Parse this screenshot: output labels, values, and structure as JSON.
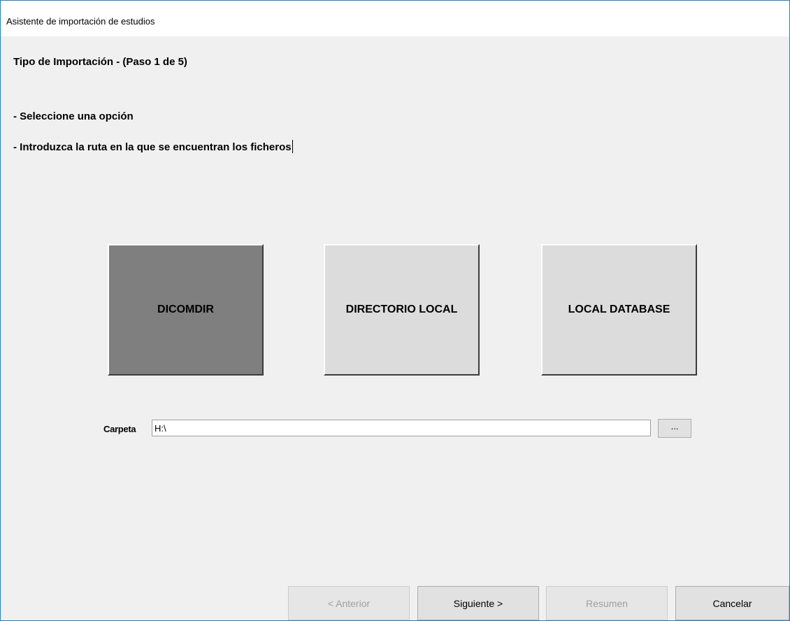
{
  "window": {
    "title": "Asistente de importación de estudios"
  },
  "step": {
    "title": "Tipo de Importación - (Paso 1 de 5)",
    "instructions": [
      "- Seleccione una opción",
      "- Introduzca la ruta en la que se encuentran los ficheros"
    ]
  },
  "options": [
    {
      "label": "DICOMDIR",
      "selected": true
    },
    {
      "label": "DIRECTORIO LOCAL",
      "selected": false
    },
    {
      "label": "LOCAL DATABASE",
      "selected": false
    }
  ],
  "folder": {
    "label": "Carpeta",
    "value": "H:\\",
    "browse_label": "..."
  },
  "buttons": {
    "prev": {
      "label": "< Anterior",
      "enabled": false
    },
    "next": {
      "label": "Siguiente >",
      "enabled": true
    },
    "summary": {
      "label": "Resumen",
      "enabled": false
    },
    "cancel": {
      "label": "Cancelar",
      "enabled": true
    }
  },
  "colors": {
    "window_border": "#1883d7",
    "selected_option": "#7f7f7f",
    "option": "#dcdcdc",
    "background": "#f0f0f0"
  }
}
